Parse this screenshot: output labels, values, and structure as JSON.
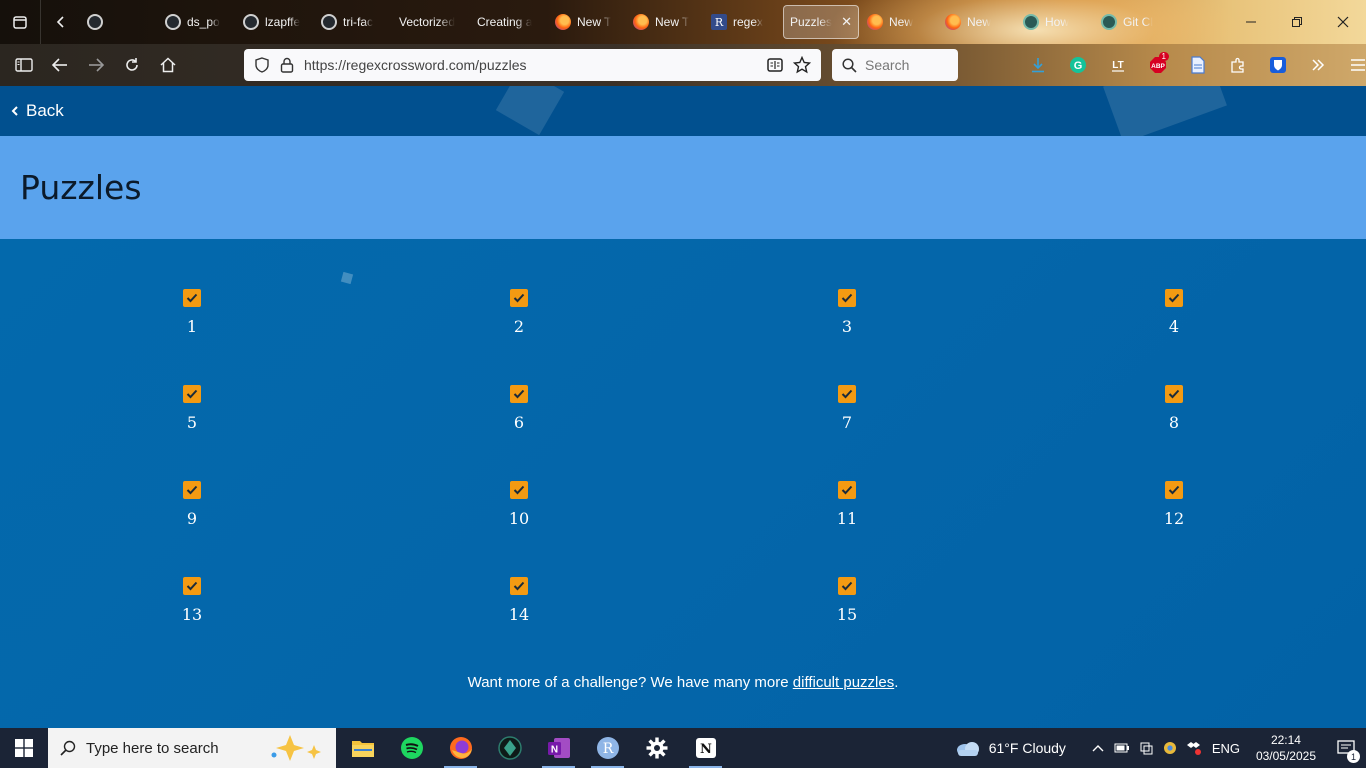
{
  "browser": {
    "tabs": [
      {
        "label": "",
        "favicon": "github",
        "active": false
      },
      {
        "label": "ds_po",
        "favicon": "github",
        "active": false
      },
      {
        "label": "lzapffe",
        "favicon": "github",
        "active": false
      },
      {
        "label": "tri-fac",
        "favicon": "github",
        "active": false
      },
      {
        "label": "Vectorized",
        "favicon": "none",
        "active": false
      },
      {
        "label": "Creating a",
        "favicon": "none",
        "active": false
      },
      {
        "label": "New T",
        "favicon": "firefox",
        "active": false
      },
      {
        "label": "New T",
        "favicon": "firefox",
        "active": false
      },
      {
        "label": "regex",
        "favicon": "regex",
        "active": false
      },
      {
        "label": "Puzzles",
        "favicon": "none",
        "active": true
      },
      {
        "label": "New",
        "favicon": "firefox",
        "active": false
      },
      {
        "label": "New",
        "favicon": "firefox",
        "active": false
      },
      {
        "label": "How",
        "favicon": "globe",
        "active": false
      },
      {
        "label": "Git Cl",
        "favicon": "globe",
        "active": false
      }
    ],
    "url": "https://regexcrossword.com/puzzles",
    "search_placeholder": "Search",
    "abp_badge": "1"
  },
  "page": {
    "back_label": "Back",
    "title": "Puzzles",
    "puzzles": [
      "1",
      "2",
      "3",
      "4",
      "5",
      "6",
      "7",
      "8",
      "9",
      "10",
      "11",
      "12",
      "13",
      "14",
      "15"
    ],
    "more_prefix": "Want more of a challenge? We have many more ",
    "more_link": "difficult puzzles",
    "more_suffix": "."
  },
  "taskbar": {
    "search_placeholder": "Type here to search",
    "weather": "61°F  Cloudy",
    "language": "ENG",
    "time": "22:14",
    "date": "03/05/2025",
    "notification_count": "1"
  },
  "colors": {
    "header": "#01508f",
    "title_band": "#5aa3ed",
    "content": "#0366aa",
    "checkbox": "#f39a12"
  }
}
